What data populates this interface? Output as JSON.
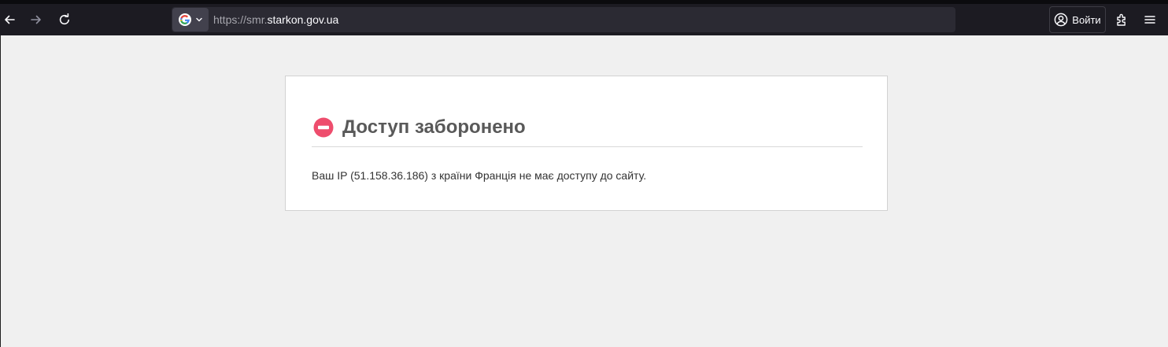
{
  "browser": {
    "url": {
      "scheme": "https://",
      "subdomain": "smr.",
      "domain": "starkon.gov.ua"
    },
    "login_label": "Войти",
    "icons": {
      "back": "arrow-left-icon",
      "forward": "arrow-right-icon",
      "reload": "reload-icon",
      "search_engine": "google-icon",
      "account": "account-circle-icon",
      "extensions": "puzzle-icon",
      "menu": "hamburger-menu-icon"
    }
  },
  "page": {
    "title": "Доступ заборонено",
    "message": "Ваш IP (51.158.36.186) з країни Франція не має доступу до сайту.",
    "colors": {
      "deny_icon": "#ee4d6d",
      "title": "#595959",
      "background": "#f0f0f0"
    }
  }
}
